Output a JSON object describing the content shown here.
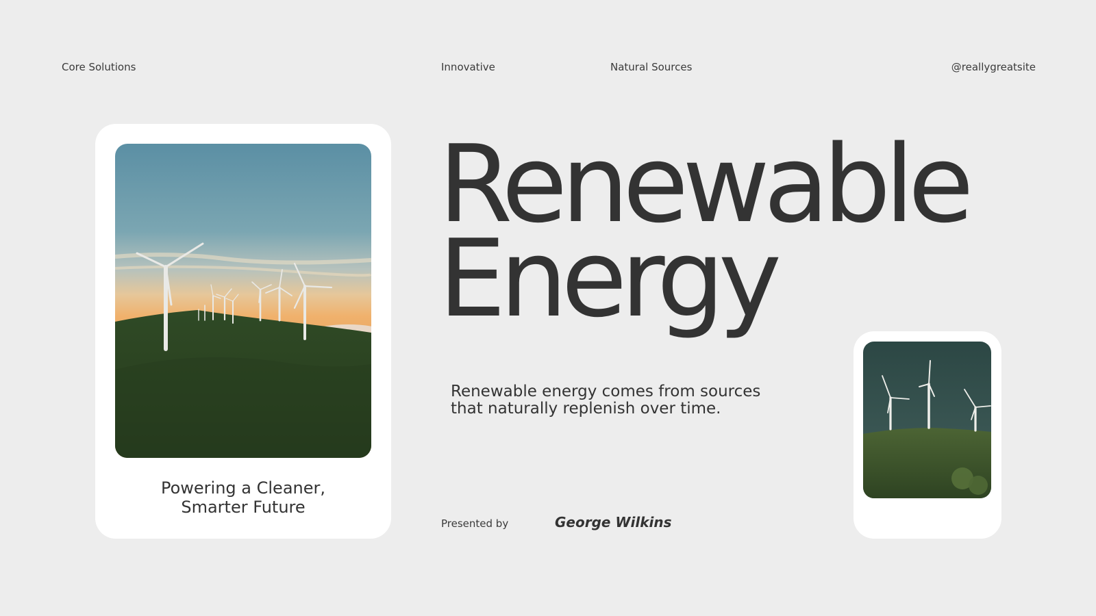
{
  "nav": {
    "left": "Core Solutions",
    "center_left": "Innovative",
    "center_right": "Natural Sources",
    "right": "@reallygreatsite"
  },
  "title": {
    "line1": "Renewable",
    "line2": "Energy"
  },
  "subtitle": "Renewable energy comes from sources that naturally replenish over time.",
  "card_left": {
    "image": "wind-turbines-sunset-photo",
    "caption_line1": "Powering a Cleaner,",
    "caption_line2": "Smarter Future"
  },
  "card_right": {
    "image": "wind-turbines-hill-photo"
  },
  "presenter": {
    "label": "Presented by",
    "name": "George Wilkins"
  },
  "colors": {
    "background": "#ededed",
    "card": "#ffffff",
    "text": "#333333"
  }
}
